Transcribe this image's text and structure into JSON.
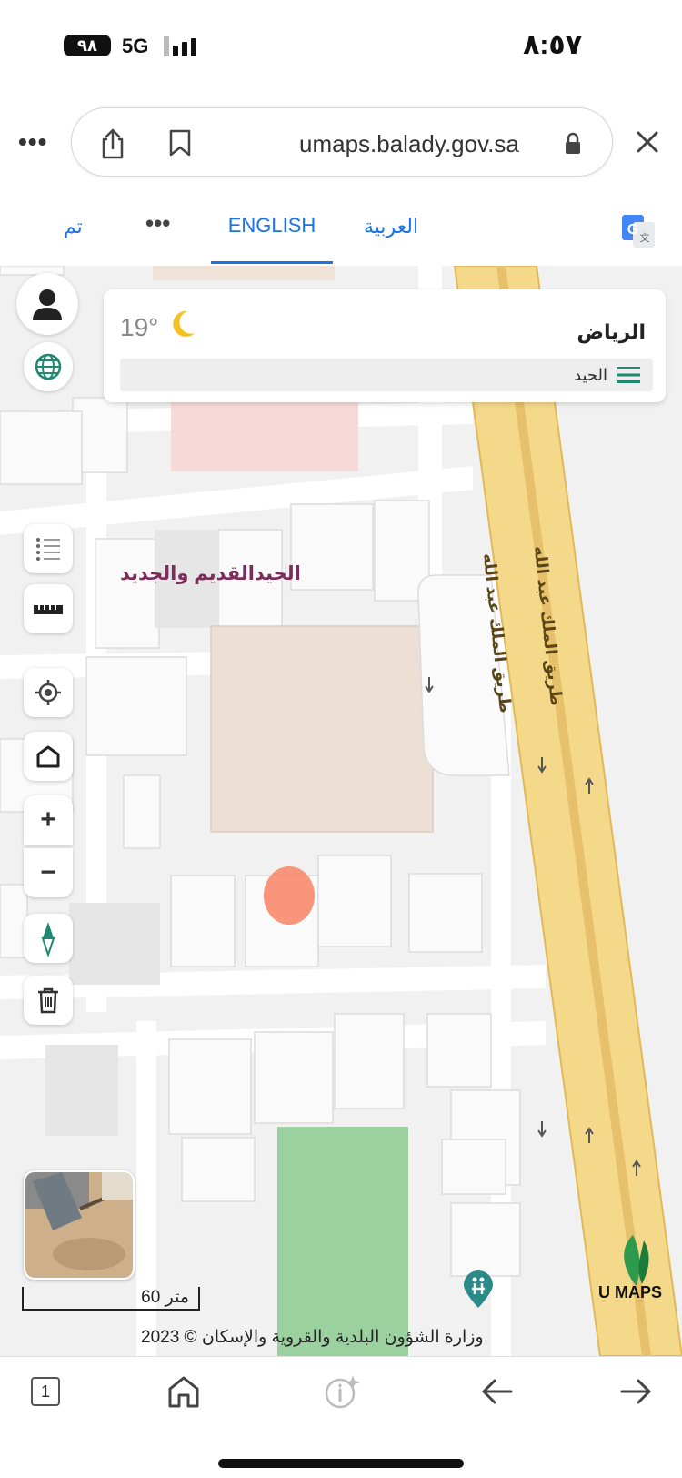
{
  "status_bar": {
    "battery": "٩٨",
    "network": "5G",
    "time": "٨:٥٧"
  },
  "browser": {
    "url": "umaps.balady.gov.sa",
    "more_icon": "more-dots-icon",
    "share_icon": "share-icon",
    "bookmark_icon": "bookmark-icon",
    "lock_icon": "lock-icon",
    "close_icon": "close-icon"
  },
  "translate_bar": {
    "done_label": "تم",
    "more_label": "•••",
    "english_label": "ENGLISH",
    "arabic_label": "العربية",
    "translate_icon": "google-translate-icon",
    "accent_color": "#1a73e8"
  },
  "map": {
    "weather": {
      "temperature": "19°",
      "city": "الرياض",
      "district": "الحيد",
      "condition_icon": "moon-icon"
    },
    "controls": [
      "user-icon",
      "globe-icon",
      "layers-list-icon",
      "ruler-icon",
      "locate-icon",
      "home-icon",
      "zoom-in-icon",
      "zoom-out-icon",
      "compass-icon",
      "trash-icon"
    ],
    "zoom_in_label": "+",
    "zoom_out_label": "−",
    "place_label": "الحيدالقديم والجديد",
    "road_label_1": "طريق الملك عبد الله",
    "road_label_2": "طريق الملك عبد الله",
    "scale": "60 متر",
    "copyright": "وزارة الشؤون البلدية والقروية والإسكان © 2023",
    "brand": "U MAPS",
    "road_color": "#f5d98a",
    "park_color": "#9bd19f",
    "marker_color": "#f7896b"
  },
  "bottom_toolbar": {
    "tab_count": "1",
    "home_icon": "home-icon",
    "info_icon": "info-sparkle-icon",
    "back_icon": "back-arrow-icon",
    "forward_icon": "forward-arrow-icon"
  }
}
